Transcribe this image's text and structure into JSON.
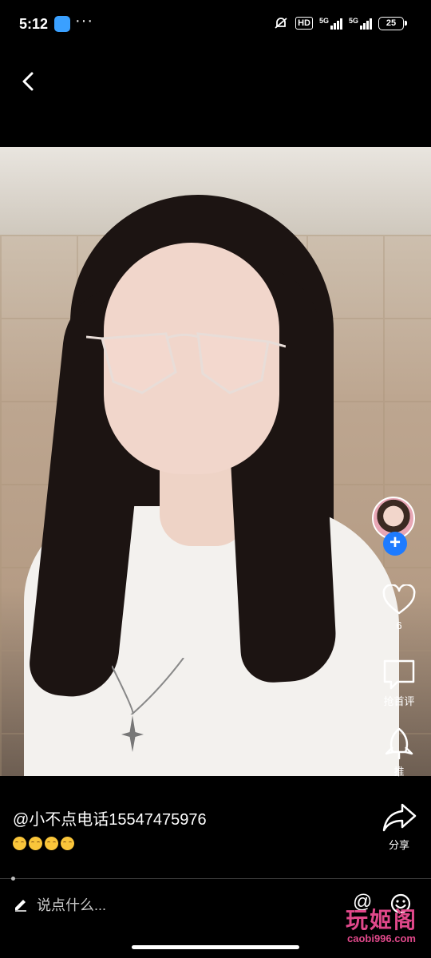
{
  "status_bar": {
    "time": "5:12",
    "dots": "···",
    "hd": "HD",
    "network_1": "5G",
    "network_2": "5G",
    "battery": "25"
  },
  "post": {
    "author_caption": "@小不点电话15547475976",
    "emoji_count": 4
  },
  "actions": {
    "like_count": "6",
    "comment_label": "抢首评",
    "boost_label": "推",
    "share_label": "分享"
  },
  "comment_bar": {
    "placeholder": "说点什么...",
    "at_label": "@"
  },
  "watermark": {
    "main": "玩姬阁",
    "sub": "caobi996.com"
  },
  "colors": {
    "background": "#000000",
    "follow_accent": "#1e7bff",
    "watermark": "#e0488a"
  }
}
